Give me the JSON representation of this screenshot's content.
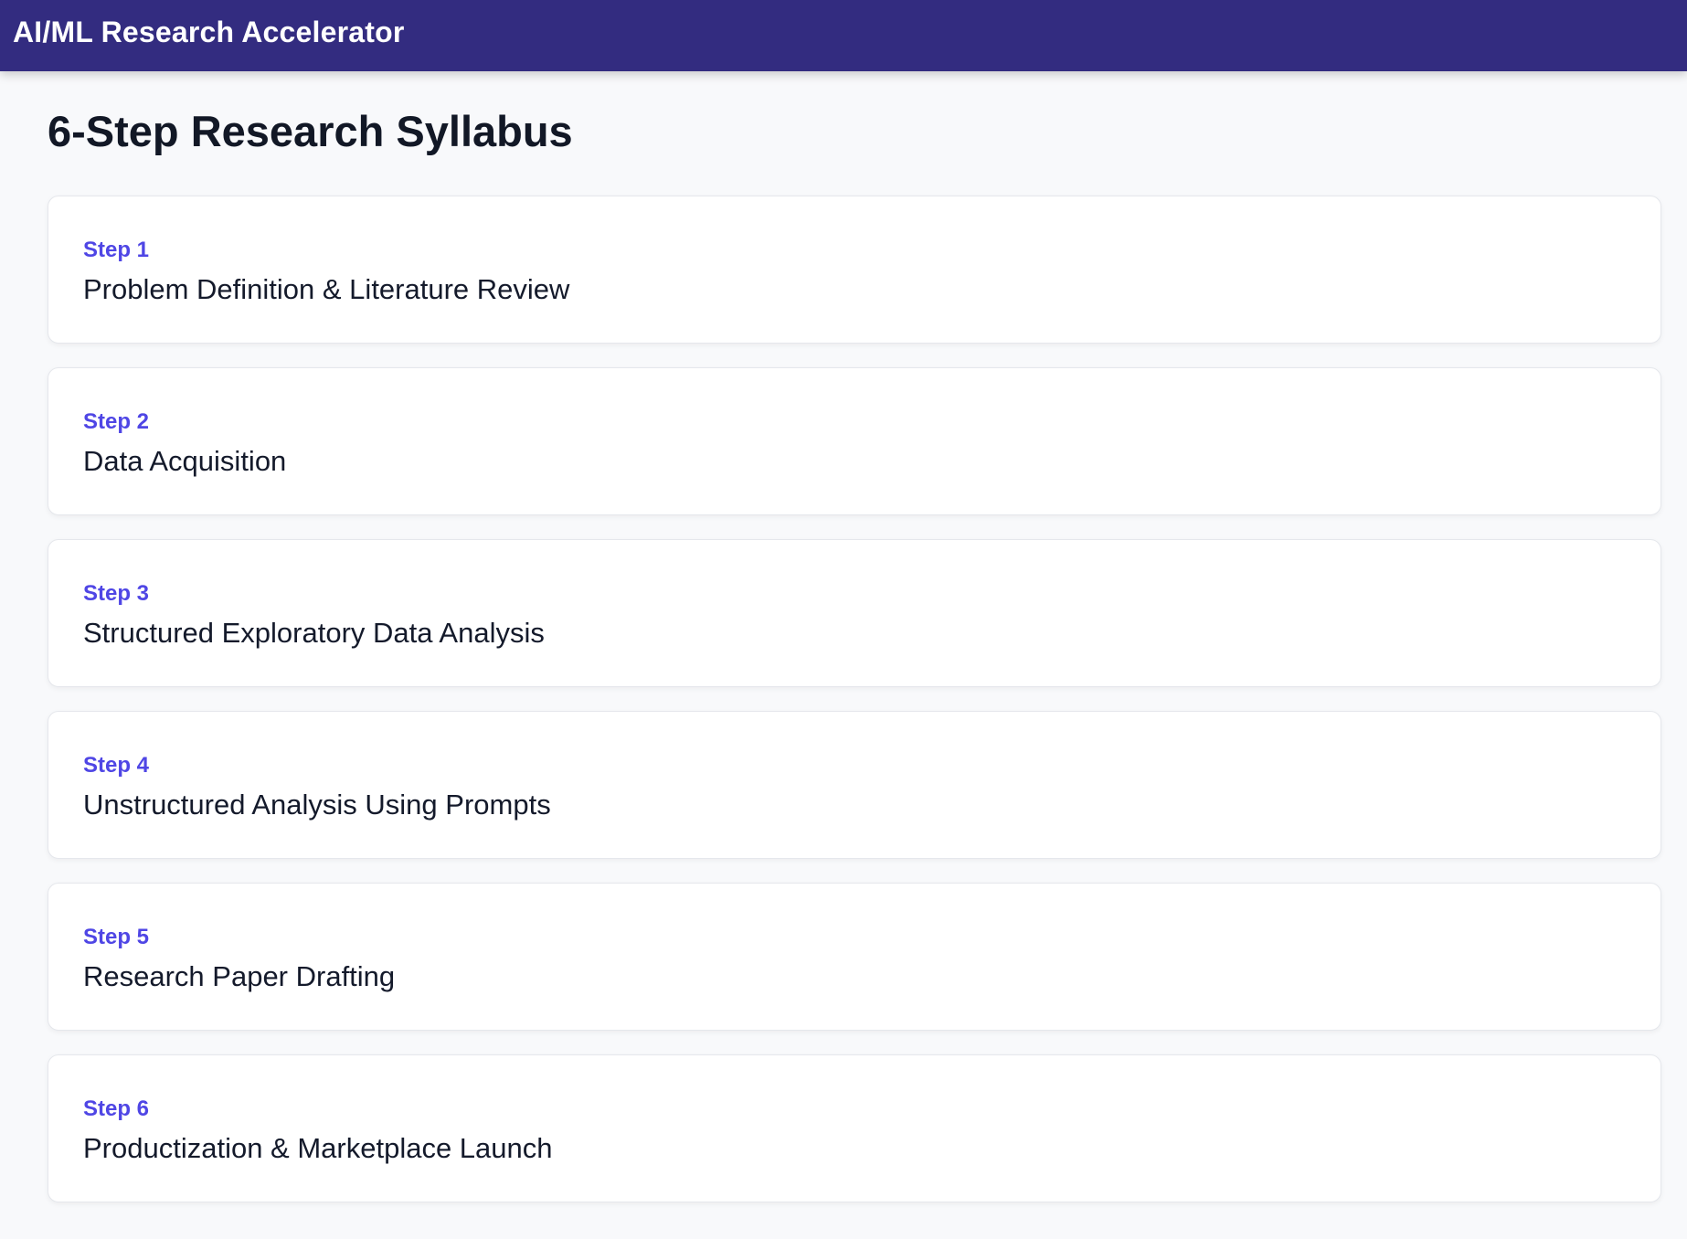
{
  "app": {
    "title": "AI/ML Research Accelerator"
  },
  "page": {
    "title": "6-Step Research Syllabus"
  },
  "steps": [
    {
      "label": "Step 1",
      "title": "Problem Definition & Literature Review"
    },
    {
      "label": "Step 2",
      "title": "Data Acquisition"
    },
    {
      "label": "Step 3",
      "title": "Structured Exploratory Data Analysis"
    },
    {
      "label": "Step 4",
      "title": "Unstructured Analysis Using Prompts"
    },
    {
      "label": "Step 5",
      "title": "Research Paper Drafting"
    },
    {
      "label": "Step 6",
      "title": "Productization & Marketplace Launch"
    }
  ],
  "colors": {
    "header_background": "#332c80",
    "step_label": "#4f46e5",
    "page_background": "#f8f9fb"
  }
}
